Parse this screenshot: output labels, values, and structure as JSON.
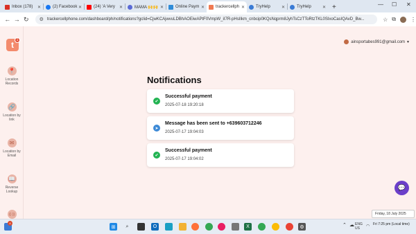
{
  "browser": {
    "tabs": [
      {
        "label": "Inbox (178)",
        "color": "#d93025"
      },
      {
        "label": "(2) Facebook",
        "color": "#1877f2"
      },
      {
        "label": "(24) 'A Very",
        "color": "#ff0000"
      },
      {
        "label": "MAMA 🙌🙌",
        "color": "#5a6ad6"
      },
      {
        "label": "Online Paym",
        "color": "#2f8cd8"
      },
      {
        "label": "trackercellph",
        "color": "#f07a52",
        "active": true
      },
      {
        "label": "TryHelp",
        "color": "#3a7bd5"
      },
      {
        "label": "TryHelp",
        "color": "#3a7bd5"
      }
    ],
    "new_tab": "+",
    "url": "trackercellphone.com/dashboard/ph/notifications?gclid=CjwKCAjwvuLDBhAOEiwAPtF0VmpW_iI7R-pHsIlkm_cnbcip0KQsNqprm8JyhTsCzTToRtzTKL0SIxoCasIQAvD_Bw..."
  },
  "sidebar": {
    "logo_letter": "t",
    "logo_badge": "1",
    "items": [
      {
        "label": "Location Records",
        "icon": "📍"
      },
      {
        "label": "Location by link",
        "icon": "🔗"
      },
      {
        "label": "Location by Email",
        "icon": "✉"
      },
      {
        "label": "Reverse Lookup",
        "icon": "📖"
      },
      {
        "label": "",
        "icon": "((·))"
      }
    ]
  },
  "user": {
    "email": "ainsportabes991@gmail.com"
  },
  "notifications": {
    "title": "Notifications",
    "items": [
      {
        "title": "Successful payment",
        "date": "2025-07-18 19:20:18",
        "icon": "check-icon"
      },
      {
        "title": "Message has been sent to +639603712246",
        "date": "2025-07-17 19:04:03",
        "icon": "send-icon"
      },
      {
        "title": "Successful payment",
        "date": "2025-07-17 19:04:02",
        "icon": "check-icon"
      }
    ]
  },
  "date_popup": "Friday, 18 July 2025",
  "taskbar": {
    "badge": "4",
    "lang_top": "ENG",
    "lang_bottom": "US",
    "clock_time": "Fri 7:25 pm (Local time)"
  }
}
